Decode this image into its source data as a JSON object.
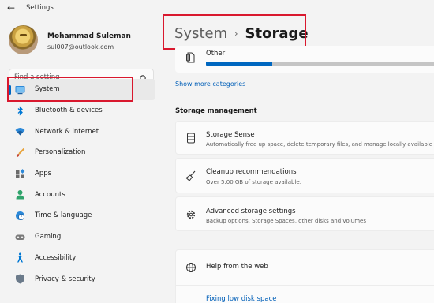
{
  "window": {
    "title": "Settings",
    "back_icon": "back-arrow-icon"
  },
  "user": {
    "name": "Mohammad Suleman",
    "email": "sul007@outlook.com"
  },
  "search": {
    "placeholder": "Find a setting",
    "value": ""
  },
  "nav": {
    "items": [
      {
        "label": "System",
        "icon": "system-icon",
        "active": true
      },
      {
        "label": "Bluetooth & devices",
        "icon": "bluetooth-icon"
      },
      {
        "label": "Network & internet",
        "icon": "wifi-icon"
      },
      {
        "label": "Personalization",
        "icon": "paintbrush-icon"
      },
      {
        "label": "Apps",
        "icon": "apps-icon"
      },
      {
        "label": "Accounts",
        "icon": "accounts-icon"
      },
      {
        "label": "Time & language",
        "icon": "clock-globe-icon"
      },
      {
        "label": "Gaming",
        "icon": "gamepad-icon"
      },
      {
        "label": "Accessibility",
        "icon": "accessibility-icon"
      },
      {
        "label": "Privacy & security",
        "icon": "shield-icon"
      }
    ]
  },
  "breadcrumb": {
    "parent": "System",
    "separator": "›",
    "current": "Storage"
  },
  "storage": {
    "other": {
      "label": "Other",
      "fill_fraction": 0.27
    },
    "show_more": "Show more categories"
  },
  "storage_management": {
    "title": "Storage management",
    "items": [
      {
        "title": "Storage Sense",
        "desc": "Automatically free up space, delete temporary files, and manage locally available",
        "icon": "storage-drive-icon"
      },
      {
        "title": "Cleanup recommendations",
        "desc": "Over 5.00 GB of storage available.",
        "icon": "broom-icon"
      },
      {
        "title": "Advanced storage settings",
        "desc": "Backup options, Storage Spaces, other disks and volumes",
        "icon": "gear-icon"
      }
    ]
  },
  "help": {
    "title": "Help from the web",
    "link": "Fixing low disk space",
    "icon": "globe-icon"
  },
  "colors": {
    "accent": "#0067c0",
    "highlight_border": "#d9182e",
    "link": "#005fb8"
  }
}
